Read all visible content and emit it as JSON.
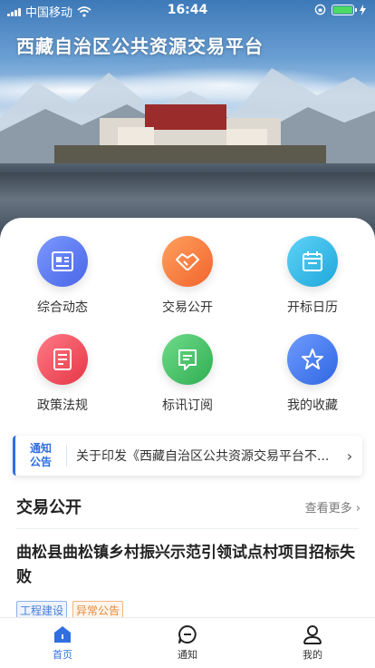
{
  "status_bar": {
    "carrier": "中国移动",
    "time": "16:44"
  },
  "hero": {
    "title": "西藏自治区公共资源交易平台"
  },
  "menu": [
    {
      "label": "综合动态",
      "icon": "news-icon",
      "color": "#5b7cf0"
    },
    {
      "label": "交易公开",
      "icon": "handshake-icon",
      "color": "#f7783a"
    },
    {
      "label": "开标日历",
      "icon": "calendar-icon",
      "color": "#27b6e6"
    },
    {
      "label": "政策法规",
      "icon": "document-icon",
      "color": "#ef4e5d"
    },
    {
      "label": "标讯订阅",
      "icon": "message-icon",
      "color": "#3fc164"
    },
    {
      "label": "我的收藏",
      "icon": "star-icon",
      "color": "#3f7ef0"
    }
  ],
  "notice": {
    "tag_line1": "通知",
    "tag_line2": "公告",
    "text": "关于印发《西藏自治区公共资源交易平台不..."
  },
  "section": {
    "title": "交易公开",
    "more": "查看更多"
  },
  "article": {
    "title": "曲松县曲松镇乡村振兴示范引领试点村项目招标失败",
    "tags": [
      "工程建设",
      "异常公告"
    ]
  },
  "tabbar": {
    "items": [
      {
        "label": "首页",
        "icon": "home-icon",
        "active": true
      },
      {
        "label": "通知",
        "icon": "chat-icon",
        "active": false
      },
      {
        "label": "我的",
        "icon": "user-icon",
        "active": false
      }
    ]
  },
  "colors": {
    "accent": "#2f6fe0",
    "tag_blue": "#4a7fd6",
    "tag_orange": "#e48a3b"
  }
}
